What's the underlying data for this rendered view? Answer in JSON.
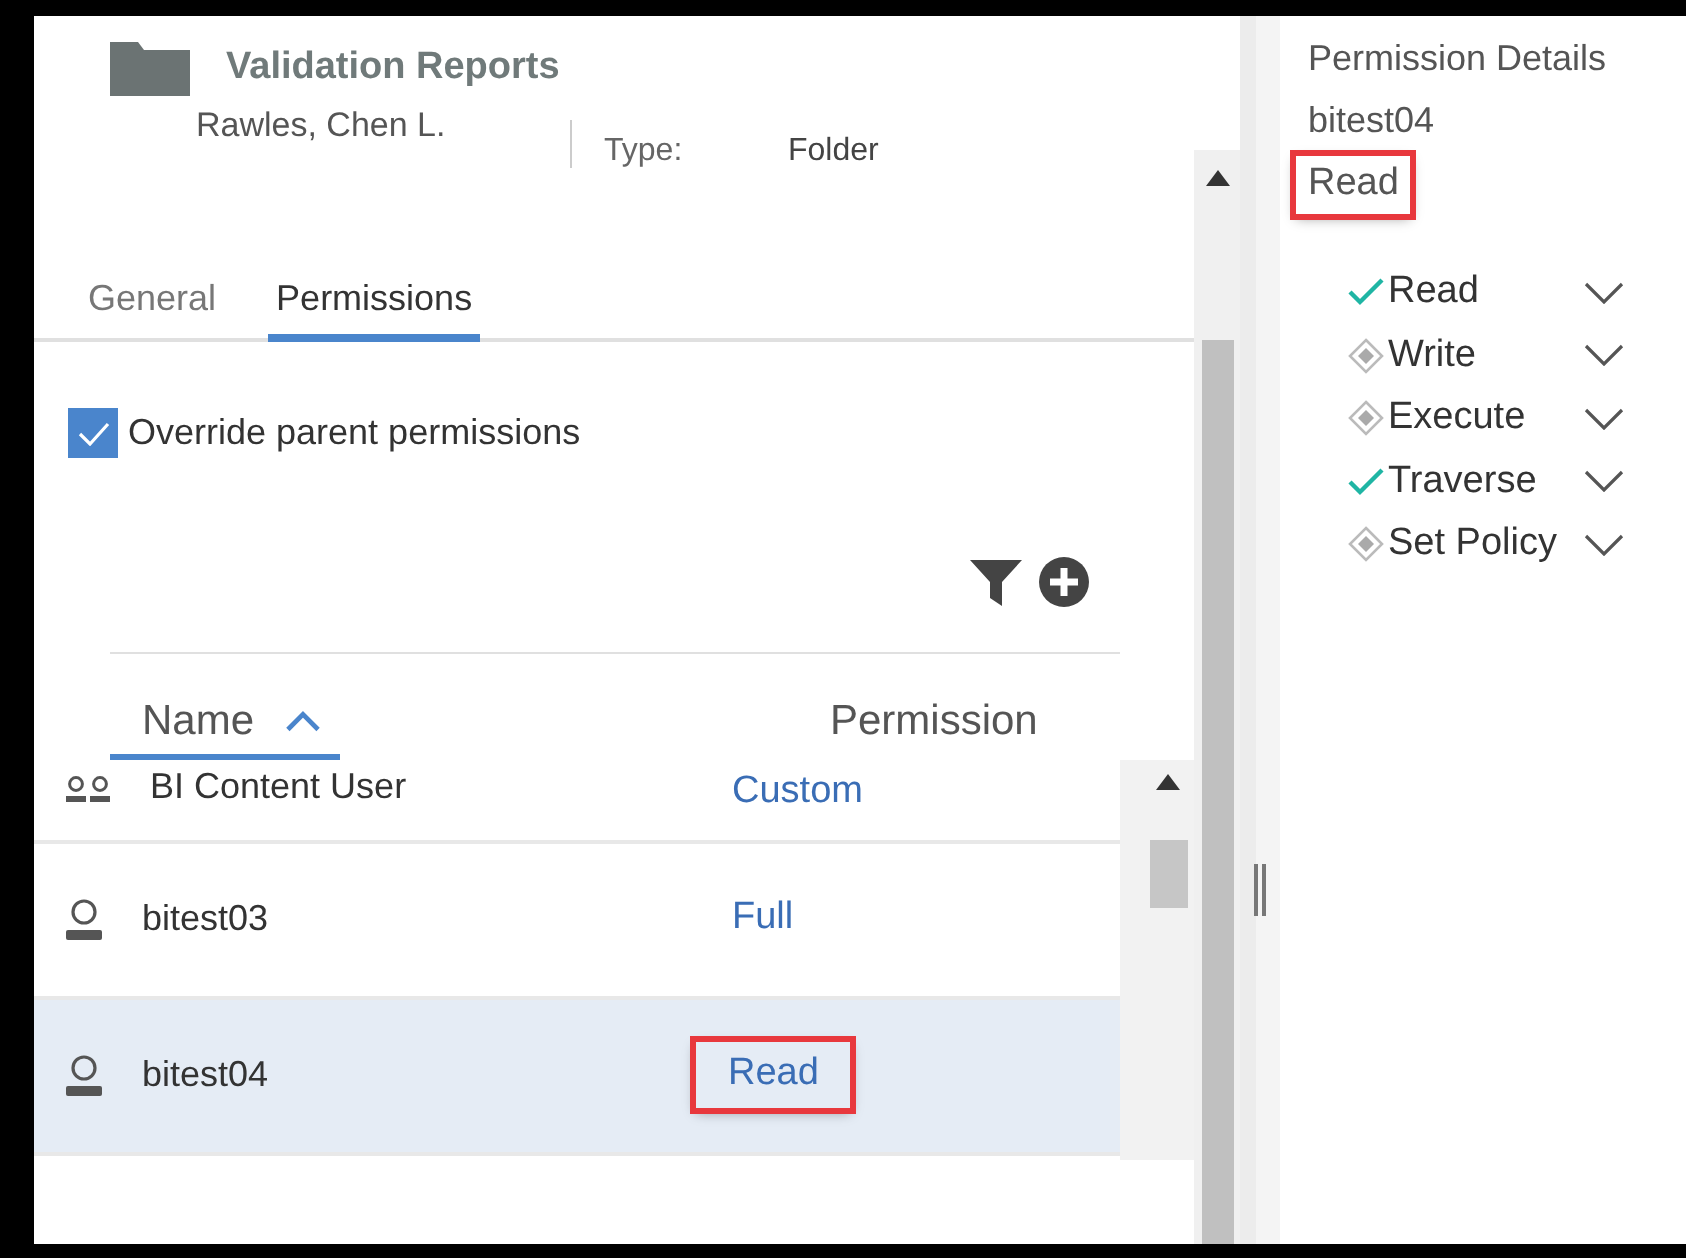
{
  "header": {
    "title": "Validation Reports",
    "owner": "Rawles, Chen L.",
    "type_label": "Type:",
    "type_value": "Folder"
  },
  "tabs": [
    {
      "label": "General",
      "selected": false
    },
    {
      "label": "Permissions",
      "selected": true
    }
  ],
  "override": {
    "label": "Override parent permissions",
    "checked": true
  },
  "table": {
    "columns": [
      {
        "label": "Name",
        "sorted": true
      },
      {
        "label": "Permission",
        "sorted": false
      }
    ],
    "rows": [
      {
        "kind": "group",
        "name": "BI Content User",
        "permission": "Custom",
        "selected": false,
        "highlighted": false
      },
      {
        "kind": "user",
        "name": "bitest03",
        "permission": "Full",
        "selected": false,
        "highlighted": false
      },
      {
        "kind": "user",
        "name": "bitest04",
        "permission": "Read",
        "selected": true,
        "highlighted": true
      }
    ]
  },
  "details": {
    "title": "Permission Details",
    "user": "bitest04",
    "permission": "Read",
    "highlighted": true,
    "items": [
      {
        "label": "Read",
        "granted": true
      },
      {
        "label": "Write",
        "granted": false
      },
      {
        "label": "Execute",
        "granted": false
      },
      {
        "label": "Traverse",
        "granted": true
      },
      {
        "label": "Set Policy",
        "granted": false
      }
    ]
  }
}
